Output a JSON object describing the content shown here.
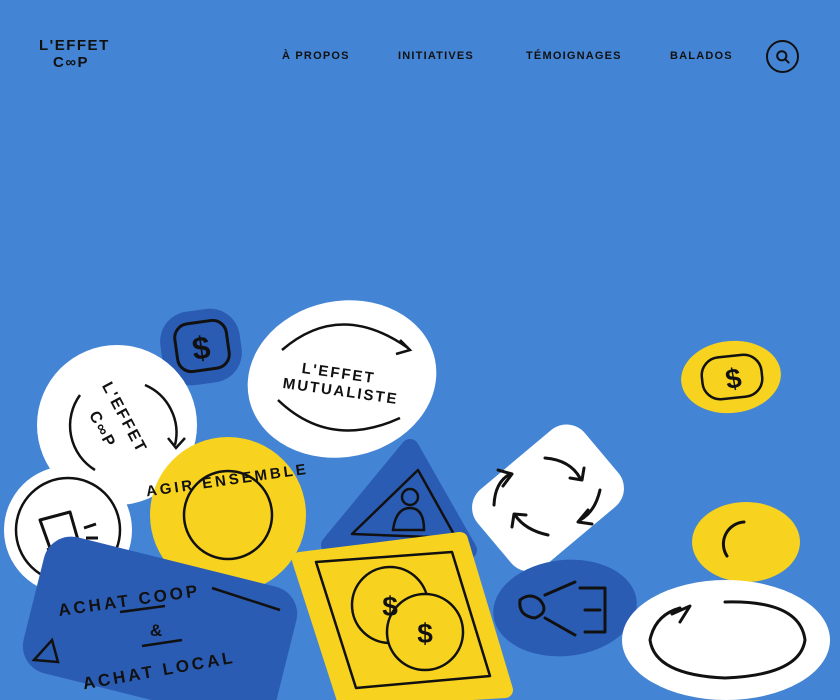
{
  "logo": {
    "line1": "L'EFFET",
    "line2": "C∞P"
  },
  "nav": {
    "items": [
      "À PROPOS",
      "INITIATIVES",
      "TÉMOIGNAGES",
      "BALADOS"
    ]
  },
  "search": {
    "icon": "search-icon"
  },
  "stickers": {
    "mutualiste_line1": "L'EFFET",
    "mutualiste_line2": "MUTUALISTE",
    "coop_line1": "L'EFFET",
    "coop_line2": "C∞P",
    "agir": "AGIR ENSEMBLE",
    "achat_line1": "ACHAT COOP",
    "achat_amp": "&",
    "achat_line2": "ACHAT LOCAL"
  },
  "colors": {
    "background": "#4484d4",
    "white": "#ffffff",
    "yellow": "#f7d21e",
    "dark_blue": "#2b5cb4",
    "ink": "#111111"
  }
}
